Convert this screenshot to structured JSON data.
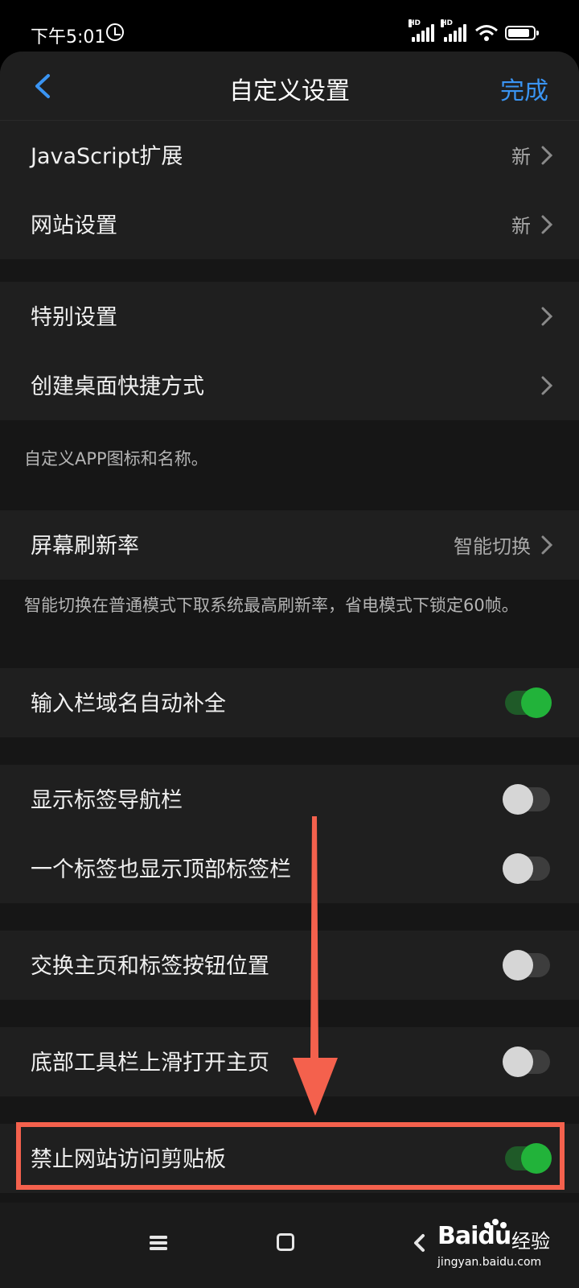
{
  "status": {
    "time": "下午5:01",
    "signal_hd_1": "HD",
    "signal_hd_2": "HD"
  },
  "header": {
    "title": "自定义设置",
    "done_label": "完成"
  },
  "rows": {
    "js_extension": {
      "label": "JavaScript扩展",
      "value": "新"
    },
    "site_settings": {
      "label": "网站设置",
      "value": "新"
    },
    "special_settings": {
      "label": "特别设置"
    },
    "desktop_shortcut": {
      "label": "创建桌面快捷方式"
    },
    "shortcut_note": "自定义APP图标和名称。",
    "refresh_rate": {
      "label": "屏幕刷新率",
      "value": "智能切换"
    },
    "refresh_note": "智能切换在普通模式下取系统最高刷新率，省电模式下锁定60帧。",
    "autocomplete": {
      "label": "输入栏域名自动补全",
      "on": true
    },
    "tab_nav_bar": {
      "label": "显示标签导航栏",
      "on": false
    },
    "single_tab_top_bar": {
      "label": "一个标签也显示顶部标签栏",
      "on": false
    },
    "swap_home_tab": {
      "label": "交换主页和标签按钮位置",
      "on": false
    },
    "swipe_open_home": {
      "label": "底部工具栏上滑打开主页",
      "on": false
    },
    "block_clipboard": {
      "label": "禁止网站访问剪贴板",
      "on": true
    }
  },
  "watermark": {
    "logo_a": "Bai",
    "logo_b": "du",
    "logo_text": "经验",
    "url": "jingyan.baidu.com"
  },
  "colors": {
    "accent": "#3a94f2",
    "toggle_on": "#22b33a",
    "highlight": "#f4614d"
  }
}
